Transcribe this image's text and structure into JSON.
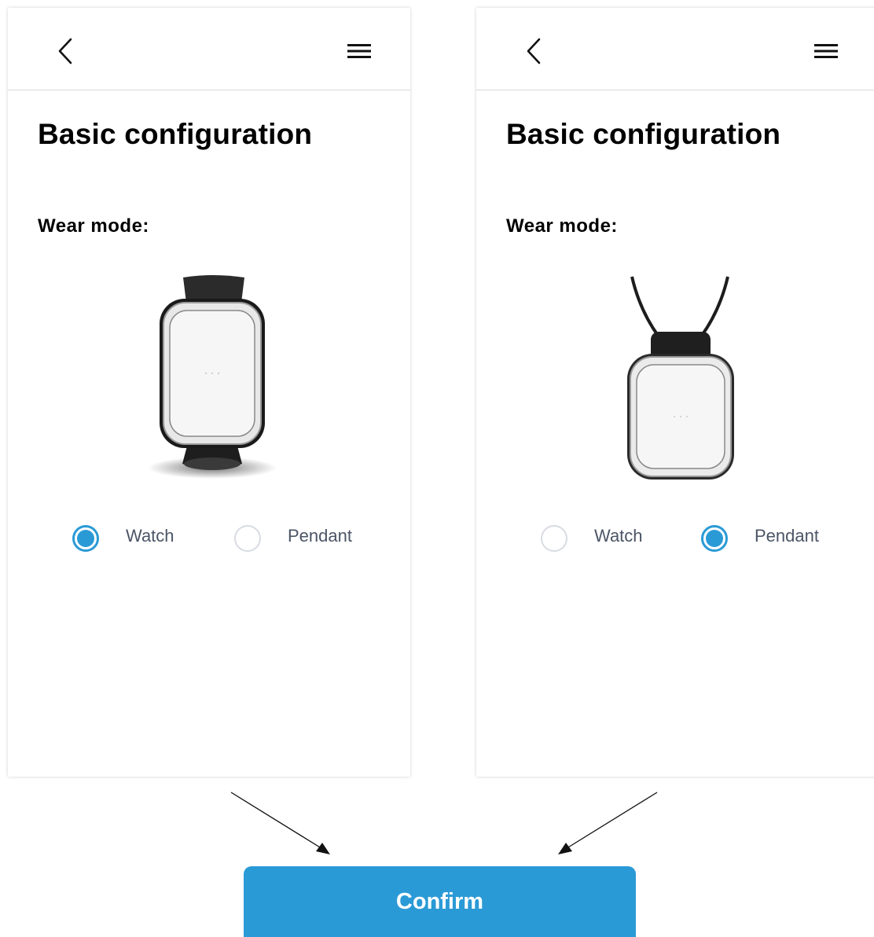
{
  "panels": [
    {
      "title": "Basic configuration",
      "wear_mode_label": "Wear mode:",
      "device_image": "watch-device",
      "selected": "Watch",
      "options": [
        {
          "label": "Watch",
          "checked": true
        },
        {
          "label": "Pendant",
          "checked": false
        }
      ]
    },
    {
      "title": "Basic configuration",
      "wear_mode_label": "Wear mode:",
      "device_image": "pendant-device",
      "selected": "Pendant",
      "options": [
        {
          "label": "Watch",
          "checked": false
        },
        {
          "label": "Pendant",
          "checked": true
        }
      ]
    }
  ],
  "icons": {
    "back": "chevron-left-icon",
    "menu": "hamburger-menu-icon"
  },
  "confirm_button": {
    "label": "Confirm"
  },
  "colors": {
    "accent": "#2a9ad6",
    "radio_border": "#d8dbe2",
    "label_text": "#4b5566",
    "heading_text": "#000000"
  }
}
